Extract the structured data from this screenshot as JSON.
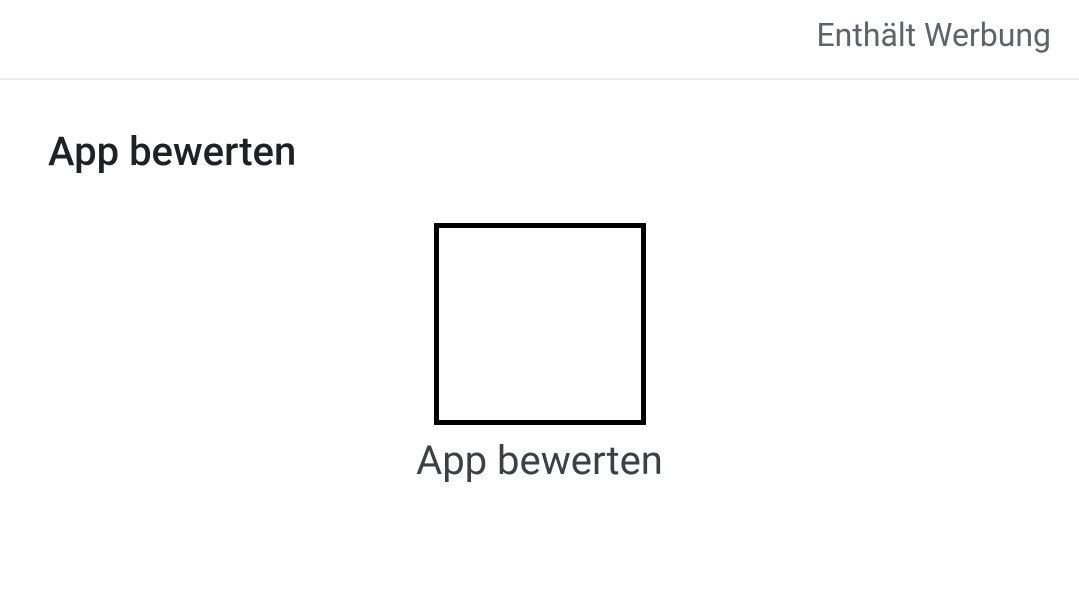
{
  "header": {
    "ads_label": "Enthält Werbung"
  },
  "rate_section": {
    "title": "App bewerten",
    "caption": "App bewerten"
  }
}
